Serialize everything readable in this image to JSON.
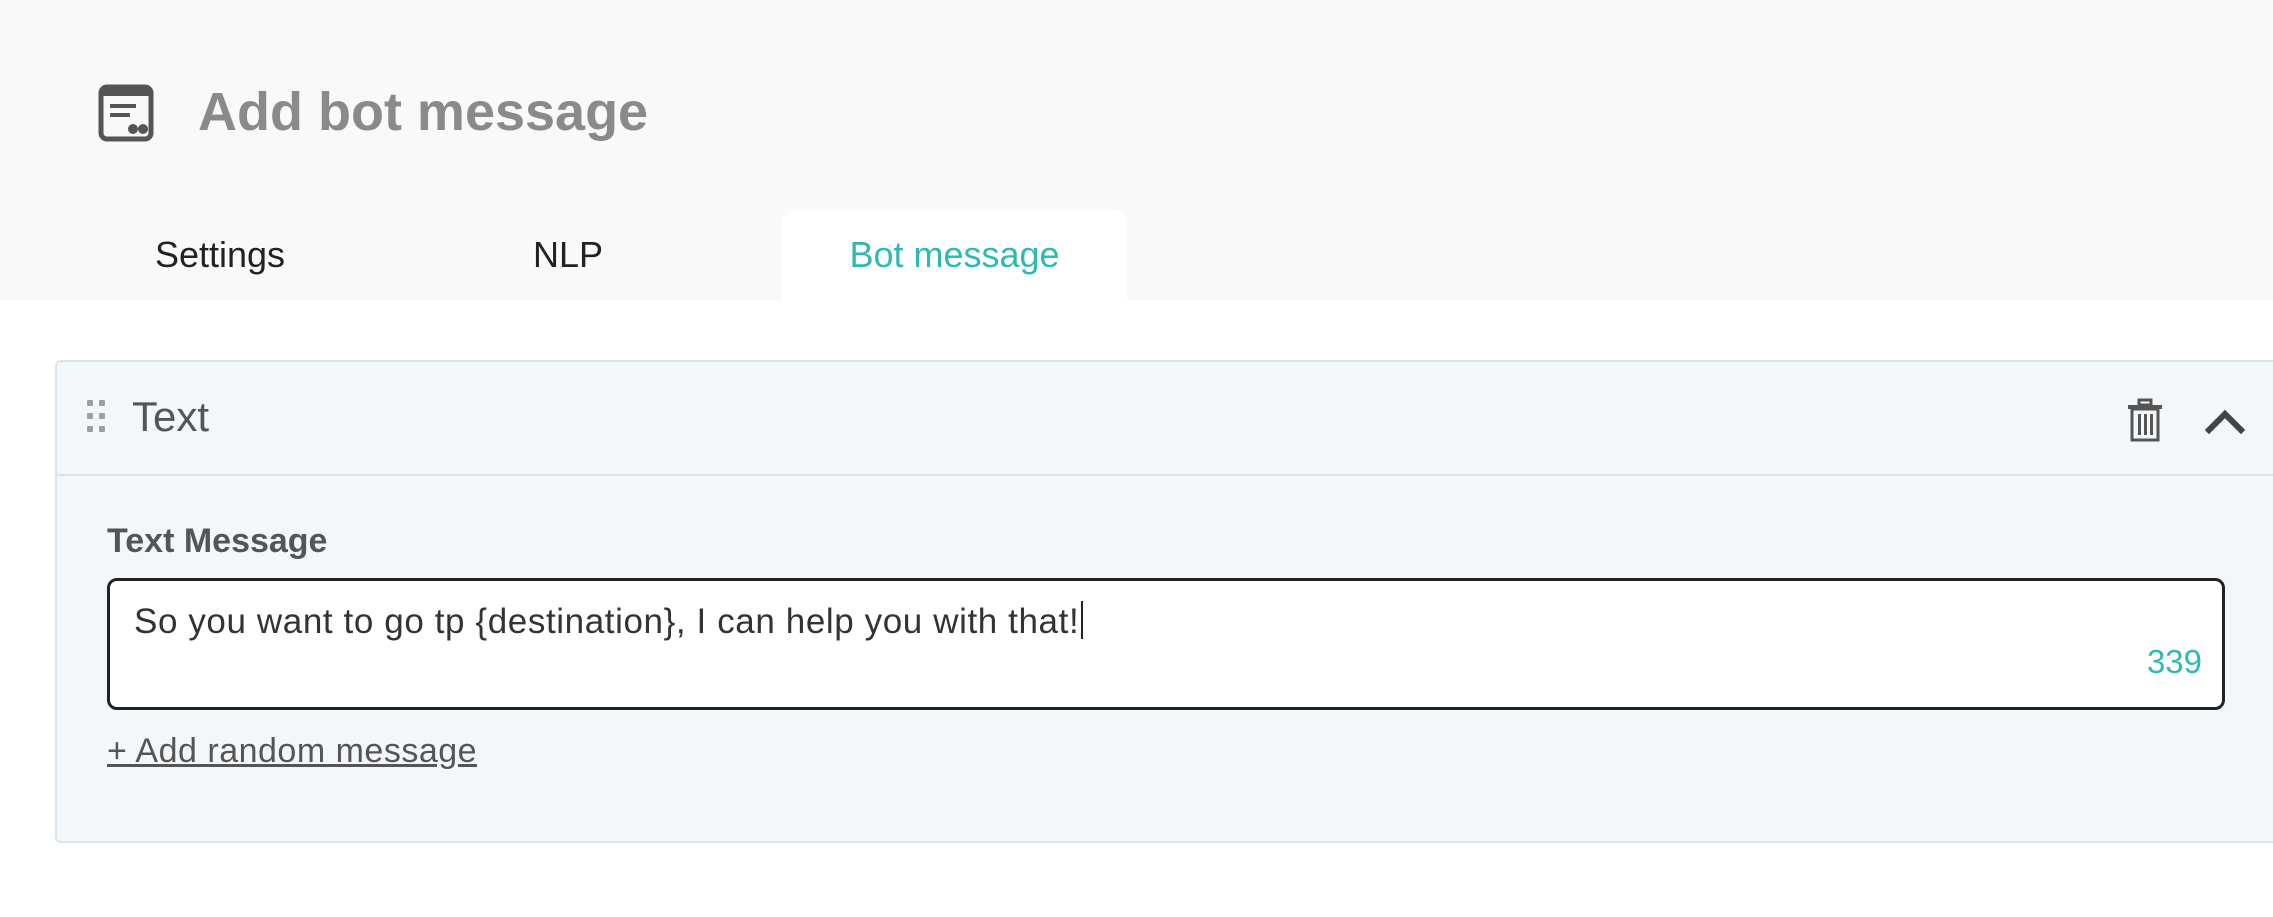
{
  "header": {
    "title": "Add bot message",
    "icon": "message-card-icon"
  },
  "tabs": [
    {
      "label": "Settings",
      "active": false
    },
    {
      "label": "NLP",
      "active": false
    },
    {
      "label": "Bot message",
      "active": true
    }
  ],
  "panel": {
    "title": "Text",
    "icons": [
      "drag-handle-icon",
      "trash-icon",
      "chevron-up-icon"
    ],
    "field_label": "Text Message",
    "message_value": "So you want to go tp {destination}, I can help you with that!",
    "char_count": "339",
    "add_link": "+ Add random message"
  },
  "colors": {
    "accent": "#30b9b4",
    "header_bg": "#f9f9f9",
    "panel_bg": "#f4f7fa",
    "panel_border": "#d9e3ec"
  }
}
